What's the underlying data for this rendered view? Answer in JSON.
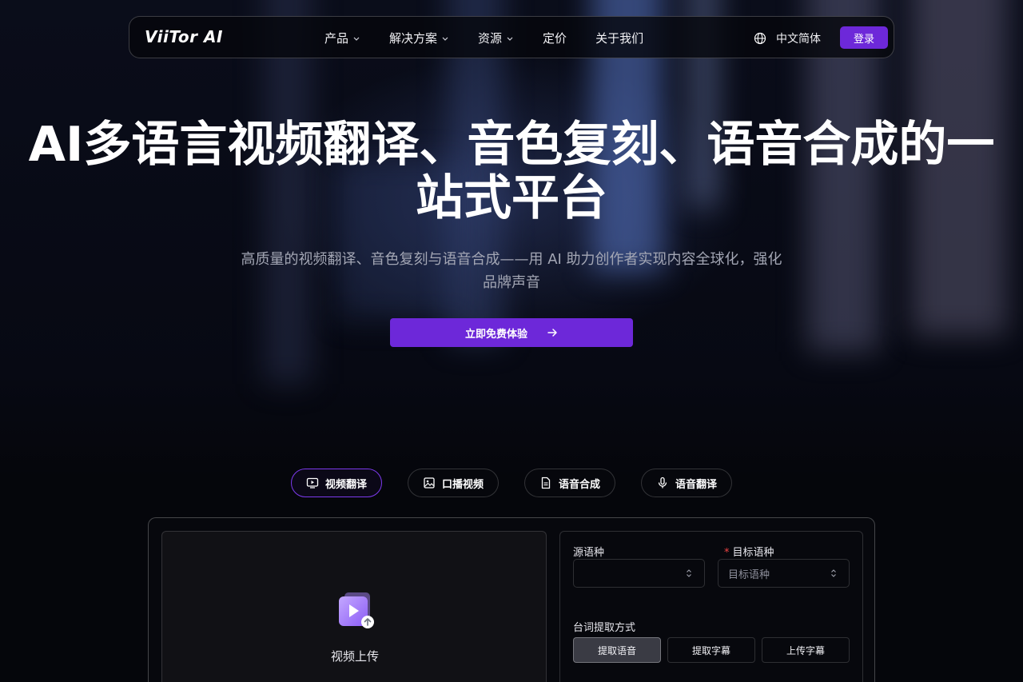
{
  "nav": {
    "logo": "ViiTor AI",
    "menu": [
      {
        "label": "产品",
        "dropdown": true
      },
      {
        "label": "解决方案",
        "dropdown": true
      },
      {
        "label": "资源",
        "dropdown": true
      },
      {
        "label": "定价",
        "dropdown": false
      },
      {
        "label": "关于我们",
        "dropdown": false
      }
    ],
    "language": "中文简体",
    "login": "登录"
  },
  "hero": {
    "title": "AI多语言视频翻译、音色复刻、语音合成的一站式平台",
    "subtitle": "高质量的视频翻译、音色复刻与语音合成——用 AI 助力创作者实现内容全球化，强化品牌声音",
    "cta": "立即免费体验"
  },
  "tabs": [
    {
      "label": "视频翻译",
      "icon": "video-play-icon",
      "active": true
    },
    {
      "label": "口播视频",
      "icon": "image-icon",
      "active": false
    },
    {
      "label": "语音合成",
      "icon": "document-icon",
      "active": false
    },
    {
      "label": "语音翻译",
      "icon": "microphone-icon",
      "active": false
    }
  ],
  "upload": {
    "label": "视频上传",
    "icon": "video-upload-icon"
  },
  "form": {
    "source_label": "源语种",
    "source_value": "",
    "target_label": "目标语种",
    "target_required": "*",
    "target_placeholder": "目标语种",
    "extract_label": "台词提取方式",
    "extract_options": [
      "提取语音",
      "提取字幕",
      "上传字幕"
    ],
    "extract_selected": "提取语音"
  },
  "colors": {
    "accent": "#6d28d9",
    "background": "#05060c",
    "required": "#ef4444"
  }
}
